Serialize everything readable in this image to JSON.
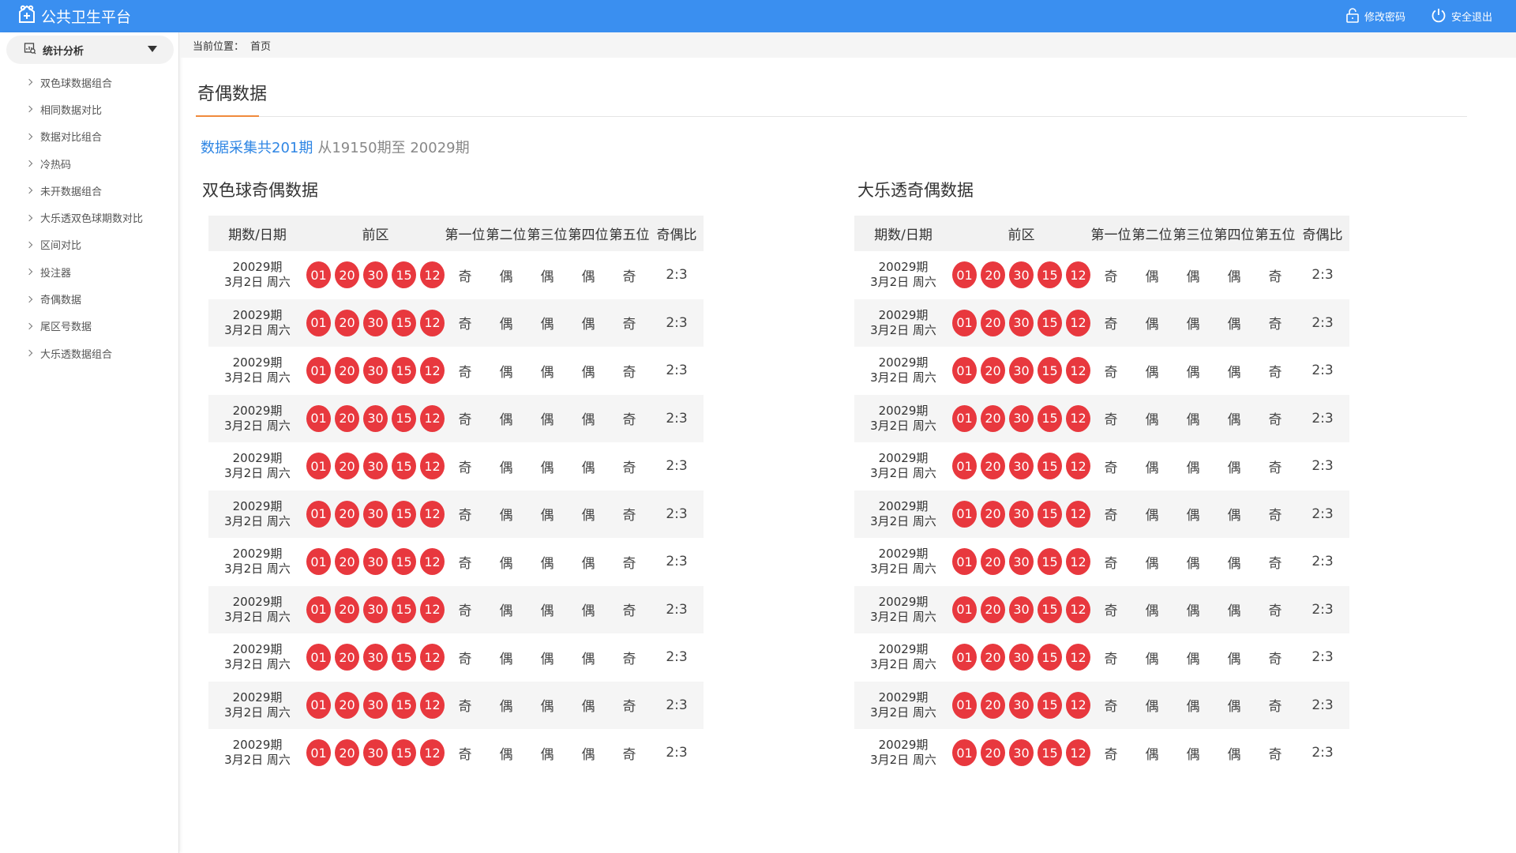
{
  "app": {
    "title": "公共卫生平台"
  },
  "topbar": {
    "change_password": "修改密码",
    "logout": "安全退出"
  },
  "sidebar": {
    "section": "统计分析",
    "items": [
      {
        "label": "双色球数据组合"
      },
      {
        "label": "相同数据对比"
      },
      {
        "label": "数据对比组合"
      },
      {
        "label": "冷热码"
      },
      {
        "label": "未开数据组合"
      },
      {
        "label": "大乐透双色球期数对比"
      },
      {
        "label": "区间对比"
      },
      {
        "label": "投注器"
      },
      {
        "label": "奇偶数据"
      },
      {
        "label": "尾区号数据"
      },
      {
        "label": "大乐透数据组合"
      }
    ]
  },
  "breadcrumb": {
    "label": "当前位置：",
    "current": "首页"
  },
  "page": {
    "title": "奇偶数据",
    "summary_highlight": "数据采集共201期",
    "summary_range": "从19150期至 20029期"
  },
  "tables": [
    {
      "title": "双色球奇偶数据",
      "headers": [
        "期数/日期",
        "前区",
        "第一位",
        "第二位",
        "第三位",
        "第四位",
        "第五位",
        "奇偶比"
      ],
      "rows": [
        {
          "period": "20029期",
          "date": "3月2日 周六",
          "balls": [
            "01",
            "20",
            "30",
            "15",
            "12"
          ],
          "p1": "奇",
          "p2": "偶",
          "p3": "偶",
          "p4": "偶",
          "p5": "奇",
          "ratio": "2:3"
        },
        {
          "period": "20029期",
          "date": "3月2日 周六",
          "balls": [
            "01",
            "20",
            "30",
            "15",
            "12"
          ],
          "p1": "奇",
          "p2": "偶",
          "p3": "偶",
          "p4": "偶",
          "p5": "奇",
          "ratio": "2:3"
        },
        {
          "period": "20029期",
          "date": "3月2日 周六",
          "balls": [
            "01",
            "20",
            "30",
            "15",
            "12"
          ],
          "p1": "奇",
          "p2": "偶",
          "p3": "偶",
          "p4": "偶",
          "p5": "奇",
          "ratio": "2:3"
        },
        {
          "period": "20029期",
          "date": "3月2日 周六",
          "balls": [
            "01",
            "20",
            "30",
            "15",
            "12"
          ],
          "p1": "奇",
          "p2": "偶",
          "p3": "偶",
          "p4": "偶",
          "p5": "奇",
          "ratio": "2:3"
        },
        {
          "period": "20029期",
          "date": "3月2日 周六",
          "balls": [
            "01",
            "20",
            "30",
            "15",
            "12"
          ],
          "p1": "奇",
          "p2": "偶",
          "p3": "偶",
          "p4": "偶",
          "p5": "奇",
          "ratio": "2:3"
        },
        {
          "period": "20029期",
          "date": "3月2日 周六",
          "balls": [
            "01",
            "20",
            "30",
            "15",
            "12"
          ],
          "p1": "奇",
          "p2": "偶",
          "p3": "偶",
          "p4": "偶",
          "p5": "奇",
          "ratio": "2:3"
        },
        {
          "period": "20029期",
          "date": "3月2日 周六",
          "balls": [
            "01",
            "20",
            "30",
            "15",
            "12"
          ],
          "p1": "奇",
          "p2": "偶",
          "p3": "偶",
          "p4": "偶",
          "p5": "奇",
          "ratio": "2:3"
        },
        {
          "period": "20029期",
          "date": "3月2日 周六",
          "balls": [
            "01",
            "20",
            "30",
            "15",
            "12"
          ],
          "p1": "奇",
          "p2": "偶",
          "p3": "偶",
          "p4": "偶",
          "p5": "奇",
          "ratio": "2:3"
        },
        {
          "period": "20029期",
          "date": "3月2日 周六",
          "balls": [
            "01",
            "20",
            "30",
            "15",
            "12"
          ],
          "p1": "奇",
          "p2": "偶",
          "p3": "偶",
          "p4": "偶",
          "p5": "奇",
          "ratio": "2:3"
        },
        {
          "period": "20029期",
          "date": "3月2日 周六",
          "balls": [
            "01",
            "20",
            "30",
            "15",
            "12"
          ],
          "p1": "奇",
          "p2": "偶",
          "p3": "偶",
          "p4": "偶",
          "p5": "奇",
          "ratio": "2:3"
        },
        {
          "period": "20029期",
          "date": "3月2日 周六",
          "balls": [
            "01",
            "20",
            "30",
            "15",
            "12"
          ],
          "p1": "奇",
          "p2": "偶",
          "p3": "偶",
          "p4": "偶",
          "p5": "奇",
          "ratio": "2:3"
        }
      ]
    },
    {
      "title": "大乐透奇偶数据",
      "headers": [
        "期数/日期",
        "前区",
        "第一位",
        "第二位",
        "第三位",
        "第四位",
        "第五位",
        "奇偶比"
      ],
      "rows": [
        {
          "period": "20029期",
          "date": "3月2日 周六",
          "balls": [
            "01",
            "20",
            "30",
            "15",
            "12"
          ],
          "p1": "奇",
          "p2": "偶",
          "p3": "偶",
          "p4": "偶",
          "p5": "奇",
          "ratio": "2:3"
        },
        {
          "period": "20029期",
          "date": "3月2日 周六",
          "balls": [
            "01",
            "20",
            "30",
            "15",
            "12"
          ],
          "p1": "奇",
          "p2": "偶",
          "p3": "偶",
          "p4": "偶",
          "p5": "奇",
          "ratio": "2:3"
        },
        {
          "period": "20029期",
          "date": "3月2日 周六",
          "balls": [
            "01",
            "20",
            "30",
            "15",
            "12"
          ],
          "p1": "奇",
          "p2": "偶",
          "p3": "偶",
          "p4": "偶",
          "p5": "奇",
          "ratio": "2:3"
        },
        {
          "period": "20029期",
          "date": "3月2日 周六",
          "balls": [
            "01",
            "20",
            "30",
            "15",
            "12"
          ],
          "p1": "奇",
          "p2": "偶",
          "p3": "偶",
          "p4": "偶",
          "p5": "奇",
          "ratio": "2:3"
        },
        {
          "period": "20029期",
          "date": "3月2日 周六",
          "balls": [
            "01",
            "20",
            "30",
            "15",
            "12"
          ],
          "p1": "奇",
          "p2": "偶",
          "p3": "偶",
          "p4": "偶",
          "p5": "奇",
          "ratio": "2:3"
        },
        {
          "period": "20029期",
          "date": "3月2日 周六",
          "balls": [
            "01",
            "20",
            "30",
            "15",
            "12"
          ],
          "p1": "奇",
          "p2": "偶",
          "p3": "偶",
          "p4": "偶",
          "p5": "奇",
          "ratio": "2:3"
        },
        {
          "period": "20029期",
          "date": "3月2日 周六",
          "balls": [
            "01",
            "20",
            "30",
            "15",
            "12"
          ],
          "p1": "奇",
          "p2": "偶",
          "p3": "偶",
          "p4": "偶",
          "p5": "奇",
          "ratio": "2:3"
        },
        {
          "period": "20029期",
          "date": "3月2日 周六",
          "balls": [
            "01",
            "20",
            "30",
            "15",
            "12"
          ],
          "p1": "奇",
          "p2": "偶",
          "p3": "偶",
          "p4": "偶",
          "p5": "奇",
          "ratio": "2:3"
        },
        {
          "period": "20029期",
          "date": "3月2日 周六",
          "balls": [
            "01",
            "20",
            "30",
            "15",
            "12"
          ],
          "p1": "奇",
          "p2": "偶",
          "p3": "偶",
          "p4": "偶",
          "p5": "奇",
          "ratio": "2:3"
        },
        {
          "period": "20029期",
          "date": "3月2日 周六",
          "balls": [
            "01",
            "20",
            "30",
            "15",
            "12"
          ],
          "p1": "奇",
          "p2": "偶",
          "p3": "偶",
          "p4": "偶",
          "p5": "奇",
          "ratio": "2:3"
        },
        {
          "period": "20029期",
          "date": "3月2日 周六",
          "balls": [
            "01",
            "20",
            "30",
            "15",
            "12"
          ],
          "p1": "奇",
          "p2": "偶",
          "p3": "偶",
          "p4": "偶",
          "p5": "奇",
          "ratio": "2:3"
        }
      ]
    }
  ],
  "colors": {
    "topbar": "#3a8ff0",
    "ball": "#e8383e",
    "accent": "#f08a3c",
    "highlight": "#2f86e4"
  },
  "icons": {
    "logo": "hospital-icon",
    "password": "lock-icon",
    "logout": "power-icon",
    "section": "chart-search-icon",
    "expand": "caret-down-icon",
    "item": "chevron-right-icon"
  }
}
